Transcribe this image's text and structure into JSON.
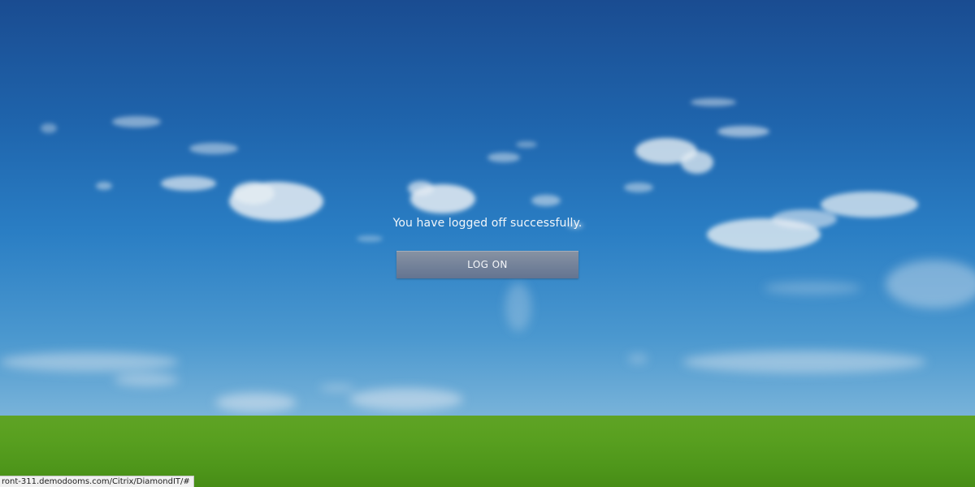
{
  "logoff": {
    "message": "You have logged off successfully.",
    "button_label": "LOG ON"
  },
  "status_bar": {
    "url": "ront-311.demodooms.com/Citrix/DiamondIT/#"
  },
  "colors": {
    "sky_top": "#1a4c91",
    "sky_bottom": "#7cb5da",
    "grass": "#59a020",
    "button": "#75839a"
  }
}
